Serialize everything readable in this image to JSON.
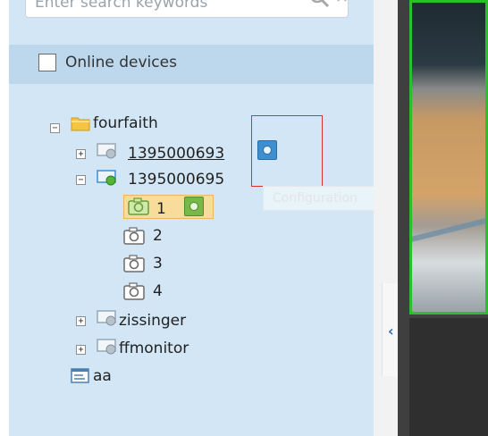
{
  "search": {
    "placeholder": "Enter search keywords"
  },
  "online_filter": {
    "label": "Online devices",
    "checked": false
  },
  "tree": {
    "root": {
      "label": "fourfaith",
      "expanded": true
    },
    "devices": [
      {
        "label": "1395000693",
        "expanded": false,
        "underlined": true
      },
      {
        "label": "1395000695",
        "expanded": true,
        "channels": [
          {
            "label": "1",
            "selected": true
          },
          {
            "label": "2"
          },
          {
            "label": "3"
          },
          {
            "label": "4"
          }
        ]
      },
      {
        "label": "zissinger",
        "expanded": false
      },
      {
        "label": "ffmonitor",
        "expanded": false
      }
    ],
    "extra": {
      "label": "aa"
    }
  },
  "tooltip": {
    "text": "Configuration"
  },
  "icons": {
    "search": "search-icon",
    "clear": "clear-icon",
    "collapse": "chevron-left-icon",
    "folder": "folder-icon",
    "device": "device-icon",
    "camera": "camera-icon",
    "config": "configuration-icon",
    "list": "list-icon"
  },
  "colors": {
    "sidebar_bg": "#d2e6f5",
    "online_bar_bg": "#bdd8ec",
    "selected_bg": "#f8dc9b",
    "highlight_box": "#d93030",
    "video_border": "#2bbf2b",
    "accent": "#2f6ea6"
  }
}
